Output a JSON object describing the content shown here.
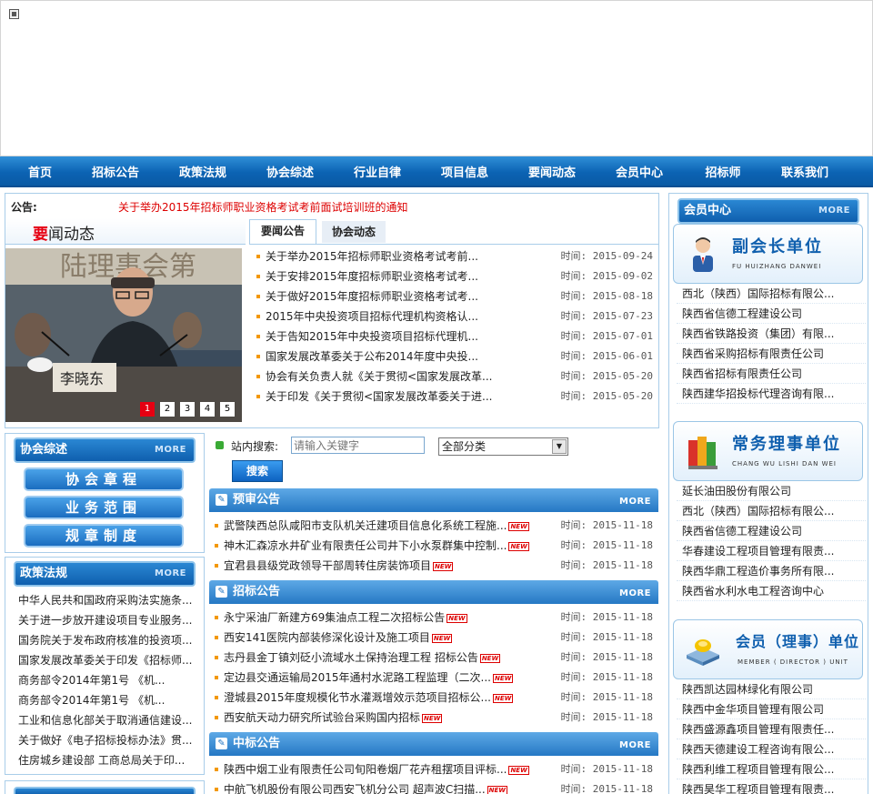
{
  "nav": [
    "首页",
    "招标公告",
    "政策法规",
    "协会综述",
    "行业自律",
    "项目信息",
    "要闻动态",
    "会员中心",
    "招标师",
    "联系我们"
  ],
  "notice": {
    "label": "公告:",
    "text": "关于举办2015年招标师职业资格考试考前面试培训班的通知"
  },
  "news": {
    "heading_first": "要",
    "heading_rest": "闻动态",
    "tabs": [
      "要闻公告",
      "协会动态"
    ],
    "photo_caption": "李晓东",
    "pages": [
      "1",
      "2",
      "3",
      "4",
      "5"
    ],
    "items": [
      {
        "title": "关于举办2015年招标师职业资格考试考前...",
        "date": "时间: 2015-09-24"
      },
      {
        "title": "关于安排2015年度招标师职业资格考试考...",
        "date": "时间: 2015-09-02"
      },
      {
        "title": "关于做好2015年度招标师职业资格考试考...",
        "date": "时间: 2015-08-18"
      },
      {
        "title": "2015年中央投资项目招标代理机构资格认...",
        "date": "时间: 2015-07-23"
      },
      {
        "title": "关于告知2015年中央投资项目招标代理机...",
        "date": "时间: 2015-07-01"
      },
      {
        "title": "国家发展改革委关于公布2014年度中央投...",
        "date": "时间: 2015-06-01"
      },
      {
        "title": "协会有关负责人就《关于贯彻<国家发展改革...",
        "date": "时间: 2015-05-20"
      },
      {
        "title": "关于印发《关于贯彻<国家发展改革委关于进...",
        "date": "时间: 2015-05-20"
      }
    ]
  },
  "assoc": {
    "title": "协会综述",
    "more": "MORE",
    "buttons": [
      "协会章程",
      "业务范围",
      "规章制度"
    ]
  },
  "policy": {
    "title": "政策法规",
    "more": "MORE",
    "items": [
      "中华人民共和国政府采购法实施条...",
      "关于进一步放开建设项目专业服务...",
      "国务院关于发布政府核准的投资项...",
      "国家发展改革委关于印发《招标师...",
      "商务部令2014年第1号 《机...",
      "商务部令2014年第1号 《机...",
      "工业和信息化部关于取消通信建设...",
      "关于做好《电子招标投标办法》贯...",
      "住房城乡建设部 工商总局关于印..."
    ]
  },
  "search": {
    "label": "站内搜索:",
    "placeholder": "请输入关键字",
    "category": "全部分类",
    "button": "搜索"
  },
  "sections": [
    {
      "title": "预审公告",
      "more": "MORE",
      "items": [
        {
          "title": "武警陕西总队咸阳市支队机关迁建项目信息化系统工程施...",
          "date": "时间: 2015-11-18"
        },
        {
          "title": "神木汇森凉水井矿业有限责任公司井下小水泵群集中控制...",
          "date": "时间: 2015-11-18"
        },
        {
          "title": "宜君县县级党政领导干部周转住房装饰项目",
          "date": "时间: 2015-11-18"
        }
      ]
    },
    {
      "title": "招标公告",
      "more": "MORE",
      "items": [
        {
          "title": "永宁采油厂新建方69集油点工程二次招标公告",
          "date": "时间: 2015-11-18"
        },
        {
          "title": "西安141医院内部装修深化设计及施工项目",
          "date": "时间: 2015-11-18"
        },
        {
          "title": "志丹县金丁镇刘砭小流域水土保持治理工程 招标公告",
          "date": "时间: 2015-11-18"
        },
        {
          "title": "定边县交通运输局2015年通村水泥路工程监理（二次...",
          "date": "时间: 2015-11-18"
        },
        {
          "title": "澄城县2015年度规模化节水灌溉增效示范项目招标公...",
          "date": "时间: 2015-11-18"
        },
        {
          "title": "西安航天动力研究所试验台采购国内招标",
          "date": "时间: 2015-11-18"
        }
      ]
    },
    {
      "title": "中标公告",
      "more": "MORE",
      "items": [
        {
          "title": "陕西中烟工业有限责任公司旬阳卷烟厂花卉租摆项目评标...",
          "date": "时间: 2015-11-18"
        },
        {
          "title": "中航飞机股份有限公司西安飞机分公司 超声波C扫描...",
          "date": "时间: 2015-11-18"
        }
      ]
    }
  ],
  "new_label": "NEW",
  "member": {
    "title": "会员中心",
    "more": "MORE",
    "groups": [
      {
        "name": "副会长单位",
        "sub": "FU HUIZHANG DANWEI",
        "items": [
          "西北（陕西）国际招标有限公...",
          "陕西省信德工程建设公司",
          "陕西省铁路投资（集团）有限...",
          "陕西省采购招标有限责任公司",
          "陕西省招标有限责任公司",
          "陕西建华招投标代理咨询有限..."
        ]
      },
      {
        "name": "常务理事单位",
        "sub": "CHANG WU LISHI DAN WEI",
        "items": [
          "延长油田股份有限公司",
          "西北（陕西）国际招标有限公...",
          "陕西省信德工程建设公司",
          "华春建设工程项目管理有限责...",
          "陕西华鼎工程造价事务所有限...",
          "陕西省水利水电工程咨询中心"
        ]
      },
      {
        "name": "会员（理事）单位",
        "sub": "MEMBER ( DIRECTOR ) UNIT",
        "items": [
          "陕西凯达园林绿化有限公司",
          "陕西中金华项目管理有限公司",
          "陕西盛源鑫项目管理有限责任...",
          "陕西天德建设工程咨询有限公...",
          "陕西利维工程项目管理有限公...",
          "陕西昊华工程项目管理有限责..."
        ]
      }
    ]
  }
}
